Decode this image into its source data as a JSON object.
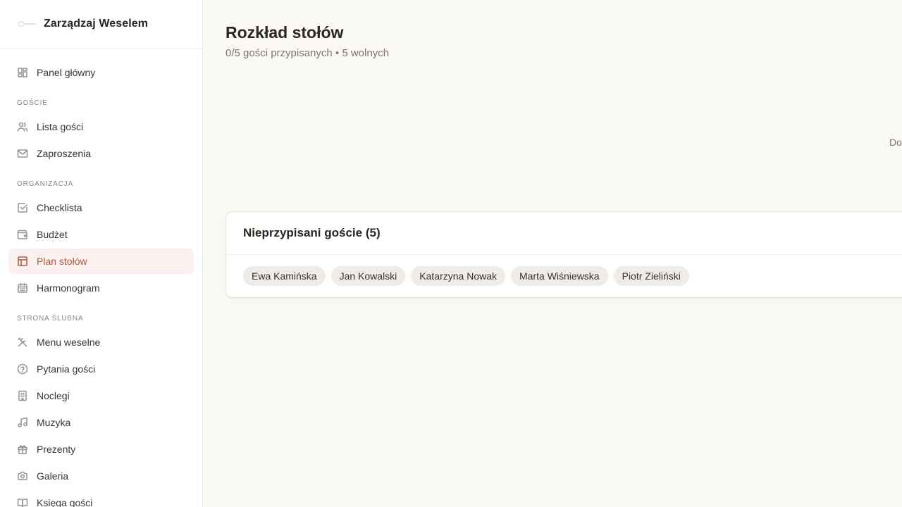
{
  "app": {
    "title": "Zarządzaj Weselem"
  },
  "sidebar": {
    "items": [
      {
        "label": "Panel główny",
        "icon": "dashboard-icon"
      },
      {
        "label": "Lista gości",
        "icon": "users-icon"
      },
      {
        "label": "Zaproszenia",
        "icon": "mail-icon"
      },
      {
        "label": "Checklista",
        "icon": "checkbox-icon"
      },
      {
        "label": "Budżet",
        "icon": "wallet-icon"
      },
      {
        "label": "Plan stołów",
        "icon": "table-layout-icon",
        "active": true
      },
      {
        "label": "Harmonogram",
        "icon": "calendar-icon"
      },
      {
        "label": "Menu weselne",
        "icon": "utensils-icon"
      },
      {
        "label": "Pytania gości",
        "icon": "question-circle-icon"
      },
      {
        "label": "Noclegi",
        "icon": "building-icon"
      },
      {
        "label": "Muzyka",
        "icon": "music-icon"
      },
      {
        "label": "Prezenty",
        "icon": "gift-icon"
      },
      {
        "label": "Galeria",
        "icon": "camera-icon"
      },
      {
        "label": "Księga gości",
        "icon": "book-icon"
      }
    ],
    "sections": {
      "guests": "GOŚCIE",
      "organization": "ORGANIZACJA",
      "website": "STRONA ŚLUBNA"
    }
  },
  "main": {
    "title": "Rozkład stołów",
    "subtitle": "0/5 gości przypisanych • 5 wolnych",
    "clipped_action": "Do",
    "unassigned": {
      "title": "Nieprzypisani goście (5)",
      "guests": [
        "Ewa Kamińska",
        "Jan Kowalski",
        "Katarzyna Nowak",
        "Marta Wiśniewska",
        "Piotr Zieliński"
      ]
    }
  },
  "colors": {
    "accent": "#b0593f",
    "active_bg": "#faf0ed",
    "background": "#f9f8f5"
  }
}
